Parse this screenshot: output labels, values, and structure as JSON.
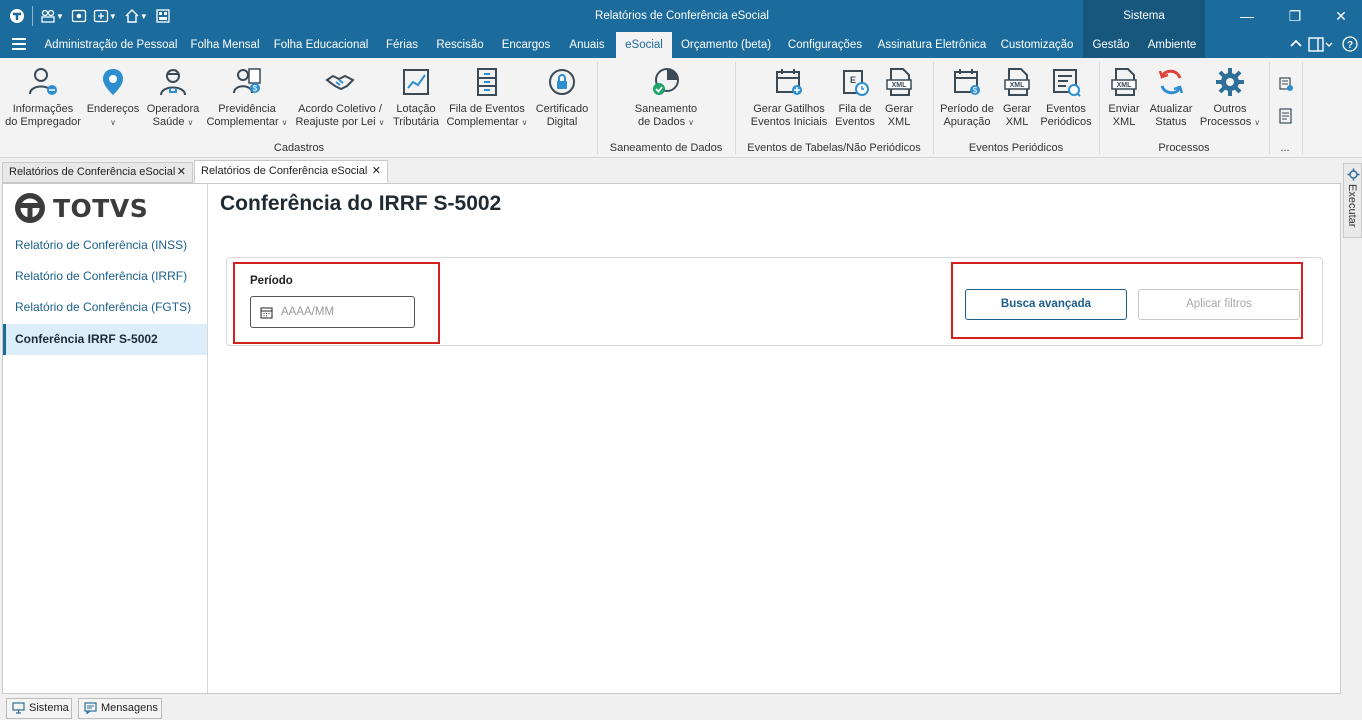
{
  "window": {
    "title": "Relatórios de Conferência eSocial",
    "module": "Sistema"
  },
  "menu": {
    "tabs": [
      {
        "label": "Administração de Pessoal"
      },
      {
        "label": "Folha Mensal"
      },
      {
        "label": "Folha Educacional"
      },
      {
        "label": "Férias"
      },
      {
        "label": "Rescisão"
      },
      {
        "label": "Encargos"
      },
      {
        "label": "Anuais"
      },
      {
        "label": "eSocial"
      },
      {
        "label": "Orçamento (beta)"
      },
      {
        "label": "Configurações"
      },
      {
        "label": "Assinatura Eletrônica"
      },
      {
        "label": "Customização"
      },
      {
        "label": "Gestão"
      },
      {
        "label": "Ambiente"
      }
    ],
    "active_tab": "eSocial"
  },
  "ribbon": {
    "cadastros": {
      "label": "Cadastros",
      "buttons": [
        {
          "line1": "Informações",
          "line2": "do Empregador"
        },
        {
          "line1": "Endereços",
          "line2": ""
        },
        {
          "line1": "Operadora",
          "line2": "Saúde"
        },
        {
          "line1": "Previdência",
          "line2": "Complementar"
        },
        {
          "line1": "Acordo Coletivo /",
          "line2": "Reajuste por Lei"
        },
        {
          "line1": "Lotação",
          "line2": "Tributária"
        },
        {
          "line1": "Fila de Eventos",
          "line2": "Complementar"
        },
        {
          "line1": "Certificado",
          "line2": "Digital"
        }
      ]
    },
    "saneamento": {
      "label": "Saneamento de Dados",
      "buttons": [
        {
          "line1": "Saneamento",
          "line2": "de Dados"
        }
      ]
    },
    "tabelas": {
      "label": "Eventos de Tabelas/Não Periódicos",
      "buttons": [
        {
          "line1": "Gerar Gatilhos",
          "line2": "Eventos Iniciais"
        },
        {
          "line1": "Fila de",
          "line2": "Eventos"
        },
        {
          "line1": "Gerar",
          "line2": "XML"
        }
      ]
    },
    "periodicos": {
      "label": "Eventos Periódicos",
      "buttons": [
        {
          "line1": "Período de",
          "line2": "Apuração"
        },
        {
          "line1": "Gerar",
          "line2": "XML"
        },
        {
          "line1": "Eventos",
          "line2": "Periódicos"
        }
      ]
    },
    "processos": {
      "label": "Processos",
      "buttons": [
        {
          "line1": "Enviar",
          "line2": "XML"
        },
        {
          "line1": "Atualizar",
          "line2": "Status"
        },
        {
          "line1": "Outros",
          "line2": "Processos"
        }
      ]
    },
    "more_label": "...",
    "xml_badge": "XML"
  },
  "doc_tabs": [
    {
      "label": "Relatórios de Conferência eSocial"
    },
    {
      "label": "Relatórios de Conferência eSocial"
    }
  ],
  "sidebar": {
    "logo_text": "TOTVS",
    "items": [
      {
        "label": "Relatório de Conferência (INSS)"
      },
      {
        "label": "Relatório de Conferência (IRRF)"
      },
      {
        "label": "Relatório de Conferência (FGTS)"
      },
      {
        "label": "Conferência IRRF S-5002"
      }
    ]
  },
  "main": {
    "title": "Conferência do IRRF S-5002",
    "periodo_label": "Período",
    "periodo_placeholder": "AAAA/MM",
    "busca_button": "Busca avançada",
    "aplicar_button": "Aplicar filtros"
  },
  "side_panel": {
    "label": "Executar"
  },
  "statusbar": {
    "sistema": "Sistema",
    "mensagens": "Mensagens"
  },
  "colors": {
    "header": "#1b6c9c",
    "accent": "#1b5f8a",
    "highlight_box": "#d0211c"
  }
}
